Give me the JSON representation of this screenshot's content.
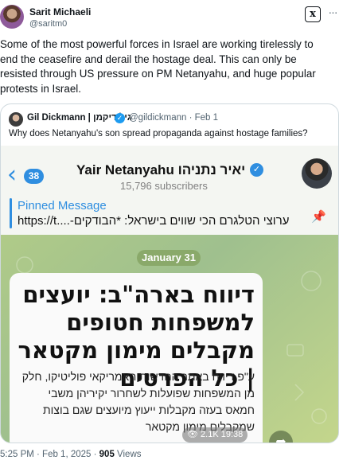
{
  "author": {
    "name": "Sarit Michaeli",
    "handle": "@saritm0"
  },
  "header": {
    "grok_label": "x",
    "more_label": "···"
  },
  "tweet": {
    "text": "Some of the most powerful forces in Israel are working tirelessly to end the ceasefire and derail the hostage deal. This can only be resisted through US pressure on PM Netanyahu, and huge popular protests in Israel."
  },
  "quote": {
    "name": "Gil Dickmann | גיל דיקמן",
    "handle_time": "@gildickmann · Feb 1",
    "text": "Why does Netanyahu's son spread propaganda against hostage families?"
  },
  "telegram": {
    "back_count": "38",
    "channel_title": "Yair Netanyahu יאיר נתניהו",
    "subscribers": "15,796 subscribers",
    "pinned_title": "Pinned Message",
    "pinned_body": "https://t....-ערוצי הטלגרם הכי שווים בישראל: *הבודקים",
    "date_pill": "January 31",
    "headline": "דיווח בארה\"ב: יועצים למשפחות חטופים מקבלים מימון מקטאר | כל הפרטים",
    "body": "ע\"פ דיווח באתר החדשות האמריקאי פוליטיקו, חלק מן המשפחות שפועלות לשחרור יקיריהן משבי חמאס בעזה מקבלות ייעוץ מיועצים שגם בוצות שמקבלים מימון מקטאר",
    "meta": "👁 2.1K 19:38"
  },
  "footer": {
    "time": "5:25 PM · Feb 1, 2025 · ",
    "views_count": "905",
    "views_label": " Views"
  },
  "colors": {
    "telegram_blue": "#2f8ee0",
    "x_blue": "#1d9bf0",
    "chat_green": "#a9c58a"
  }
}
